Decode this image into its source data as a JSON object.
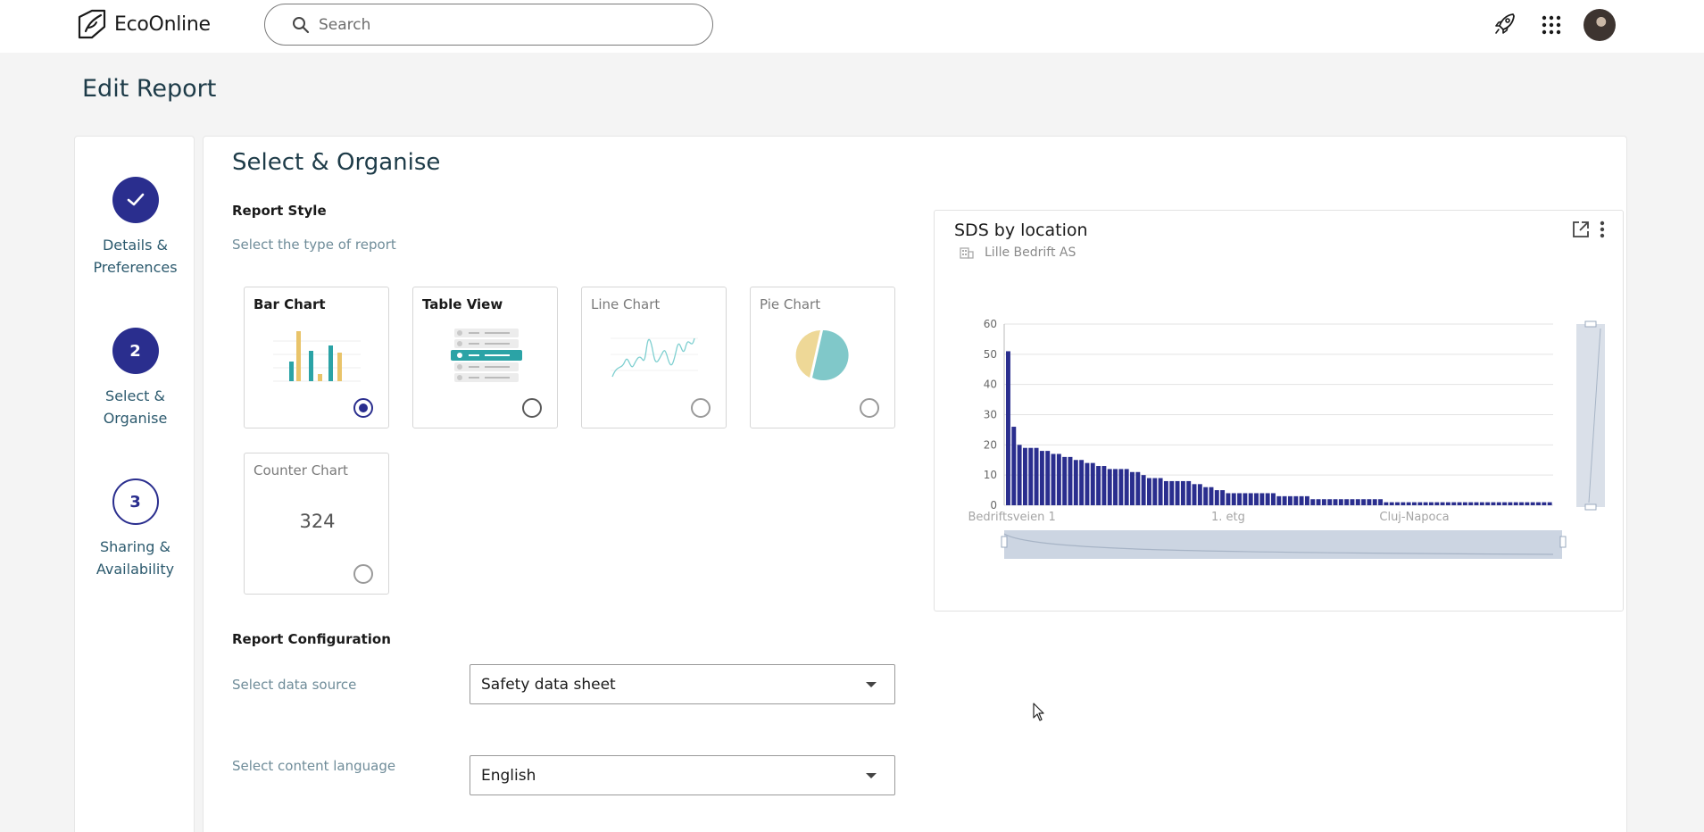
{
  "app": {
    "name": "EcoOnline"
  },
  "search": {
    "placeholder": "Search"
  },
  "header_icons": [
    "rocket-icon",
    "apps-grid-icon",
    "user-avatar"
  ],
  "page": {
    "title": "Edit Report"
  },
  "steps": [
    {
      "number": "",
      "label_line1": "Details &",
      "label_line2": "Preferences",
      "state": "complete"
    },
    {
      "number": "2",
      "label_line1": "Select &",
      "label_line2": "Organise",
      "state": "current"
    },
    {
      "number": "3",
      "label_line1": "Sharing &",
      "label_line2": "Availability",
      "state": "upcoming"
    }
  ],
  "main": {
    "title": "Select & Organise",
    "report_style": {
      "heading": "Report Style",
      "hint": "Select the type of report"
    },
    "cards": [
      {
        "label": "Bar Chart",
        "selected": true
      },
      {
        "label": "Table View",
        "selected": false
      },
      {
        "label": "Line Chart",
        "selected": false
      },
      {
        "label": "Pie Chart",
        "selected": false
      },
      {
        "label": "Counter Chart",
        "selected": false,
        "value": "324"
      }
    ],
    "config": {
      "heading": "Report Configuration",
      "data_source_label": "Select data source",
      "data_source_value": "Safety data sheet",
      "language_label": "Select content language",
      "language_value": "English"
    }
  },
  "widget": {
    "title": "SDS by location",
    "subtitle": "Lille Bedrift AS"
  },
  "colors": {
    "primary": "#2a2e8e",
    "teal": "#2ba3a6",
    "title": "#1d3b48",
    "muted": "#6f8c99"
  },
  "chart_data": {
    "type": "bar",
    "title": "SDS by location",
    "ylim": [
      0,
      60
    ],
    "yticks": [
      0,
      10,
      20,
      30,
      40,
      50,
      60
    ],
    "x_tick_labels": [
      "Bedriftsveien 1",
      "1. etg",
      "Cluj-Napoca"
    ],
    "grid": true,
    "values": [
      51,
      26,
      20,
      19,
      19,
      19,
      18,
      18,
      17,
      17,
      16,
      16,
      15,
      15,
      14,
      14,
      13,
      13,
      12,
      12,
      12,
      12,
      11,
      11,
      10,
      9,
      9,
      9,
      8,
      8,
      8,
      8,
      8,
      7,
      7,
      6,
      6,
      5,
      5,
      4,
      4,
      4,
      4,
      4,
      4,
      4,
      4,
      4,
      3,
      3,
      3,
      3,
      3,
      3,
      2,
      2,
      2,
      2,
      2,
      2,
      2,
      2,
      2,
      2,
      2,
      2,
      2,
      1,
      1,
      1,
      1,
      1,
      1,
      1,
      1,
      1,
      1,
      1,
      1,
      1,
      1,
      1,
      1,
      1,
      1,
      1,
      1,
      1,
      1,
      1,
      1,
      1,
      1,
      1,
      1,
      1,
      1
    ]
  }
}
